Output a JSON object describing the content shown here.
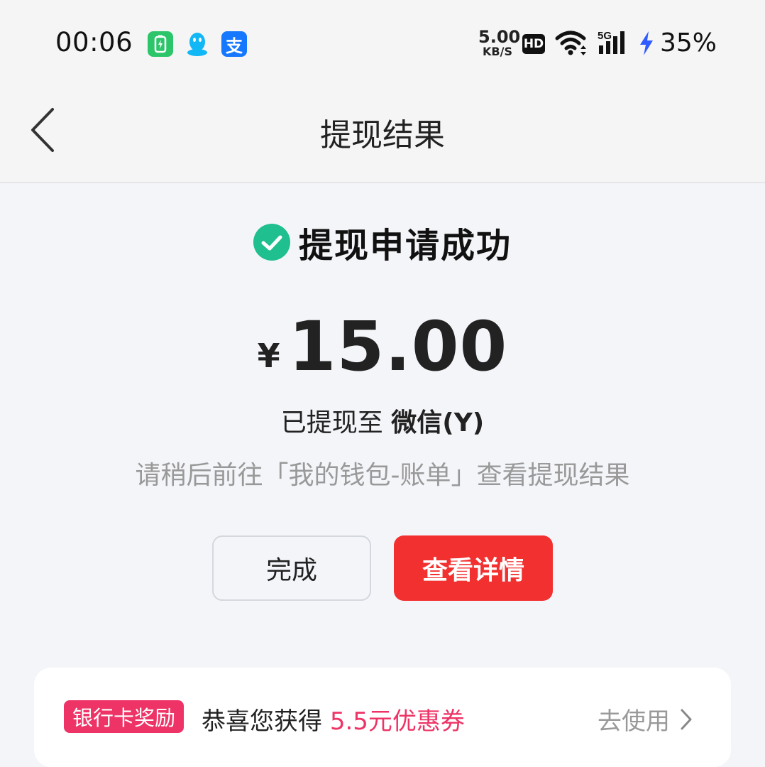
{
  "status_bar": {
    "time": "00:06",
    "net_speed_value": "5.00",
    "net_speed_unit": "KB/S",
    "hd": "HD",
    "network": "5G",
    "battery": "35%",
    "app_icons": [
      "battery-app-icon",
      "qq-icon",
      "alipay-icon"
    ],
    "alipay_glyph": "支"
  },
  "nav": {
    "title": "提现结果"
  },
  "result": {
    "title": "提现申请成功",
    "currency": "¥",
    "amount": "15.00",
    "dest_prefix": "已提现至 ",
    "dest_name": "微信(Y)",
    "hint": "请稍后前往「我的钱包-账单」查看提现结果"
  },
  "buttons": {
    "done": "完成",
    "detail": "查看详情"
  },
  "reward": {
    "badge": "银行卡奖励",
    "text": "恭喜您获得 ",
    "highlight": "5.5元优惠券",
    "action": "去使用"
  },
  "colors": {
    "success": "#1fbf8f",
    "primary_red": "#f23030",
    "badge_pink": "#ee3366"
  }
}
